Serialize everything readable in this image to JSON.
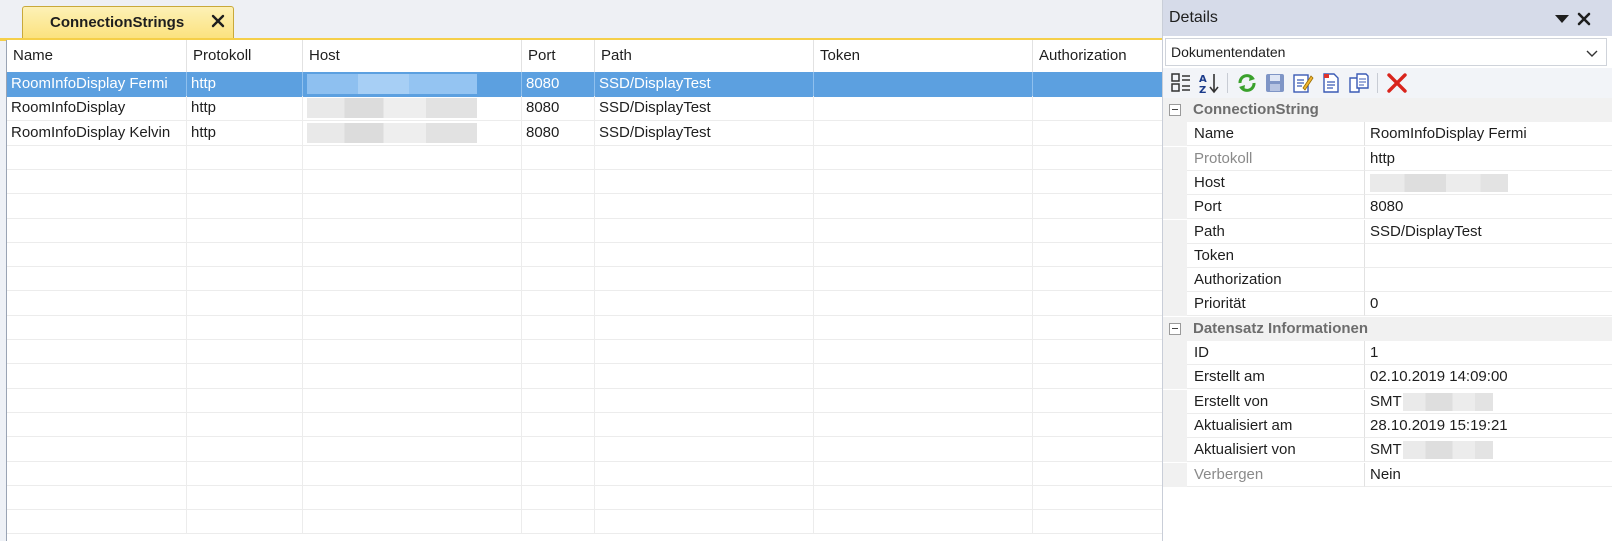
{
  "document": {
    "tab_label": "ConnectionStrings",
    "columns": [
      "Name",
      "Protokoll",
      "Host",
      "Port",
      "Path",
      "Token",
      "Authorization"
    ],
    "rows": [
      {
        "name": "RoomInfoDisplay Fermi",
        "protokoll": "http",
        "port": "8080",
        "path": "SSD/DisplayTest",
        "token": "",
        "authorization": "",
        "selected": true
      },
      {
        "name": "RoomInfoDisplay",
        "protokoll": "http",
        "port": "8080",
        "path": "SSD/DisplayTest",
        "token": "",
        "authorization": "",
        "selected": false
      },
      {
        "name": "RoomInfoDisplay Kelvin",
        "protokoll": "http",
        "port": "8080",
        "path": "SSD/DisplayTest",
        "token": "",
        "authorization": "",
        "selected": false
      }
    ]
  },
  "details": {
    "title": "Details",
    "combo_value": "Dokumentendaten",
    "toolbar_icons": [
      "categorized-icon",
      "sort-az-icon",
      "refresh-icon",
      "save-icon",
      "edit-icon",
      "new-document-icon",
      "copy-icon",
      "delete-icon"
    ],
    "categories": [
      {
        "label": "ConnectionString",
        "props": [
          {
            "name": "Name",
            "value": "RoomInfoDisplay Fermi"
          },
          {
            "name": "Protokoll",
            "value": "http",
            "dim": true
          },
          {
            "name": "Host",
            "value": ""
          },
          {
            "name": "Port",
            "value": "8080"
          },
          {
            "name": "Path",
            "value": "SSD/DisplayTest"
          },
          {
            "name": "Token",
            "value": ""
          },
          {
            "name": "Authorization",
            "value": ""
          },
          {
            "name": "Priorität",
            "value": "0"
          }
        ]
      },
      {
        "label": "Datensatz Informationen",
        "props": [
          {
            "name": "ID",
            "value": "1"
          },
          {
            "name": "Erstellt am",
            "value": "02.10.2019 14:09:00"
          },
          {
            "name": "Erstellt von",
            "value": "SMT"
          },
          {
            "name": "Aktualisiert am",
            "value": "28.10.2019 15:19:21"
          },
          {
            "name": "Aktualisiert von",
            "value": "SMT"
          },
          {
            "name": "Verbergen",
            "value": "Nein",
            "dim": true
          }
        ]
      }
    ]
  },
  "colors": {
    "selection": "#5ca0e0",
    "tab_accent": "#f5cf49",
    "details_header": "#d6dbe9",
    "delete_red": "#d9241c"
  }
}
